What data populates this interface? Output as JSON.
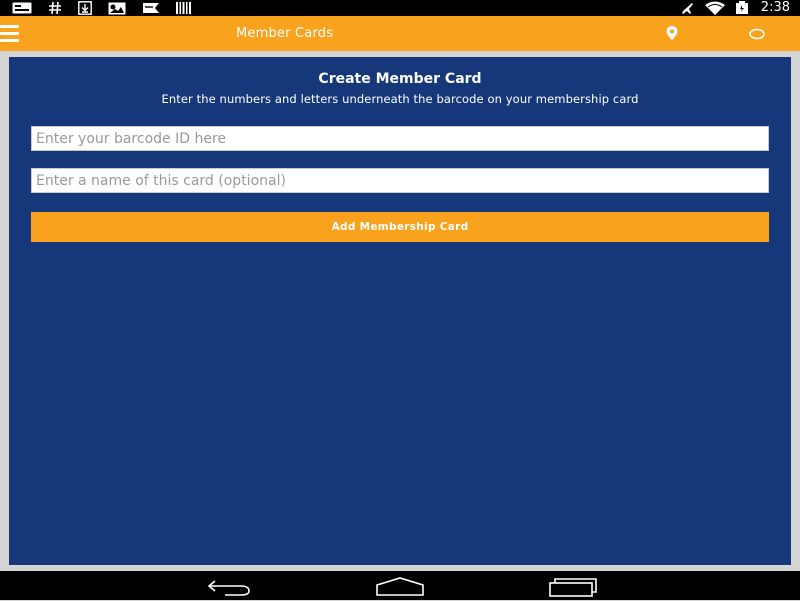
{
  "status_bar": {
    "time": "2:38",
    "left_icons": [
      "notification-card-icon",
      "hash-icon",
      "download-icon",
      "photo-icon",
      "bookmark-icon",
      "barcode-icon"
    ],
    "right_icons": [
      "airplane-icon",
      "wifi-icon",
      "battery-icon"
    ]
  },
  "app_bar": {
    "title": "Member Cards",
    "color": "#f8a21e",
    "icons": [
      "menu-icon",
      "location-pin-icon",
      "search-icon"
    ]
  },
  "form": {
    "title": "Create Member Card",
    "subtitle": "Enter the numbers and letters underneath the barcode on your membership card",
    "barcode_placeholder": "Enter your barcode ID here",
    "barcode_value": "",
    "name_placeholder": "Enter a name of this card (optional)",
    "name_value": "",
    "submit_label": "Add Membership Card",
    "panel_color": "#16387b",
    "accent_color": "#f8a21e"
  },
  "nav_bar": {
    "icons": [
      "back-icon",
      "home-icon",
      "recents-icon"
    ]
  }
}
